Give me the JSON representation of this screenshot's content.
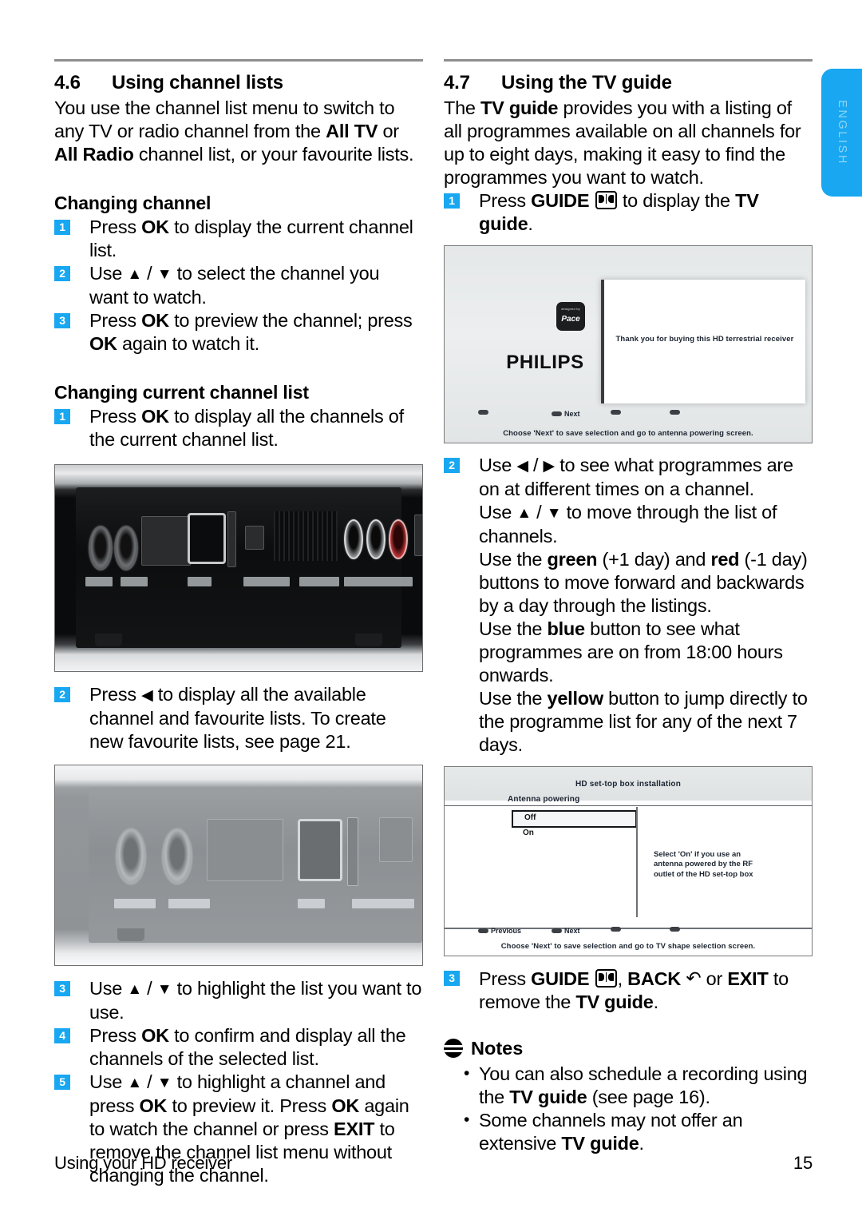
{
  "language_tab": {
    "label": "ENGLISH"
  },
  "left_column": {
    "section": {
      "number": "4.6",
      "title": "Using channel lists"
    },
    "intro": "You use the channel list menu to switch to any TV or radio channel from the All TV or All Radio channel list, or your favourite lists.",
    "intro_bold_1": "All TV",
    "intro_bold_2": "All Radio",
    "subheads": {
      "changing_channel": "Changing channel",
      "changing_current_channel_list": "Changing current channel list"
    },
    "changing_channel_steps": [
      {
        "num": "1",
        "text": "Press OK to display the current channel list."
      },
      {
        "num": "2",
        "text": "Use ▲ / ▼ to select the channel you want to watch."
      },
      {
        "num": "3",
        "text": "Press OK to preview the channel; press OK again to watch it."
      }
    ],
    "changing_list_steps": [
      {
        "num": "1",
        "text": "Press OK to display all the channels of the current channel list."
      },
      {
        "num": "2",
        "text": "Press ◀ to display all the available channel and favourite lists. To create new favourite lists, see page 21."
      },
      {
        "num": "3",
        "text": "Use ▲ / ▼ to highlight the list you want to use."
      },
      {
        "num": "4",
        "text": "Press OK to confirm and display all the channels of the selected list."
      },
      {
        "num": "5",
        "text": "Use ▲ / ▼ to highlight a channel and press OK to preview it. Press OK again to watch the channel or press EXIT to remove the channel list menu without changing the channel."
      }
    ],
    "figure_1": {
      "caption": "rear-panel-connectors-photo-dark"
    },
    "figure_2": {
      "caption": "rear-panel-connectors-photo-light"
    }
  },
  "right_column": {
    "section": {
      "number": "4.7",
      "title": "Using the TV guide"
    },
    "intro": "The TV guide provides you with a listing of all programmes available on all channels for up to eight days, making it easy to find the programmes you want to watch.",
    "step_1": {
      "num": "1",
      "text_before": "Press ",
      "key": "GUIDE",
      "text_after": " to display the ",
      "target": "TV guide",
      "text_end": "."
    },
    "step_2": {
      "num": "2",
      "line_1": "Use ◀ / ▶ to see what programmes are on at different times on a channel.",
      "line_2": "Use ▲ / ▼ to move through the list of channels.",
      "line_3_a": "Use the ",
      "line_3_green": "green",
      "line_3_b": " (+1 day) and ",
      "line_3_red": "red",
      "line_3_c": " (-1 day) buttons to move forward and backwards by a day through the listings.",
      "line_4_a": "Use the ",
      "line_4_blue": "blue",
      "line_4_b": " button to see what programmes are on from 18:00 hours onwards.",
      "line_5_a": "Use the ",
      "line_5_yellow": "yellow",
      "line_5_b": " button to jump directly to the programme list for any of the next 7 days."
    },
    "step_3": {
      "num": "3",
      "t1": "Press ",
      "k1": "GUIDE",
      "t2": ", ",
      "k2": "BACK",
      "t3": " or ",
      "k3": "EXIT",
      "t4": " to remove the ",
      "k4": "TV guide",
      "t5": "."
    },
    "notes": {
      "heading": "Notes",
      "items": [
        {
          "a": "You can also schedule a recording using the ",
          "b": "TV guide",
          "c": " (see page 16)."
        },
        {
          "a": "Some channels may not offer an extensive ",
          "b": "TV guide",
          "c": "."
        }
      ]
    },
    "screenshot_welcome": {
      "brand": "PHILIPS",
      "badge_designed": "designed by",
      "badge_name": "Pace",
      "message": "Thank you for buying this HD terrestrial receiver",
      "button_next": "Next",
      "hint": "Choose 'Next' to save selection and go to antenna powering screen."
    },
    "screenshot_antenna": {
      "title": "HD set-top box installation",
      "subtitle": "Antenna powering",
      "option_selected": "Off",
      "option_other": "On",
      "help_text": "Select 'On' if you use an antenna powered by the RF outlet of the HD set-top box",
      "button_previous": "Previous",
      "button_next": "Next",
      "hint": "Choose 'Next' to save selection and go to TV shape selection screen."
    }
  },
  "footer": {
    "chapter": "Using your HD receiver",
    "page_number": "15"
  },
  "colors": {
    "accent_blue": "#18A7F0",
    "rule_grey": "#8e8e8e",
    "text_black": "#000000"
  }
}
